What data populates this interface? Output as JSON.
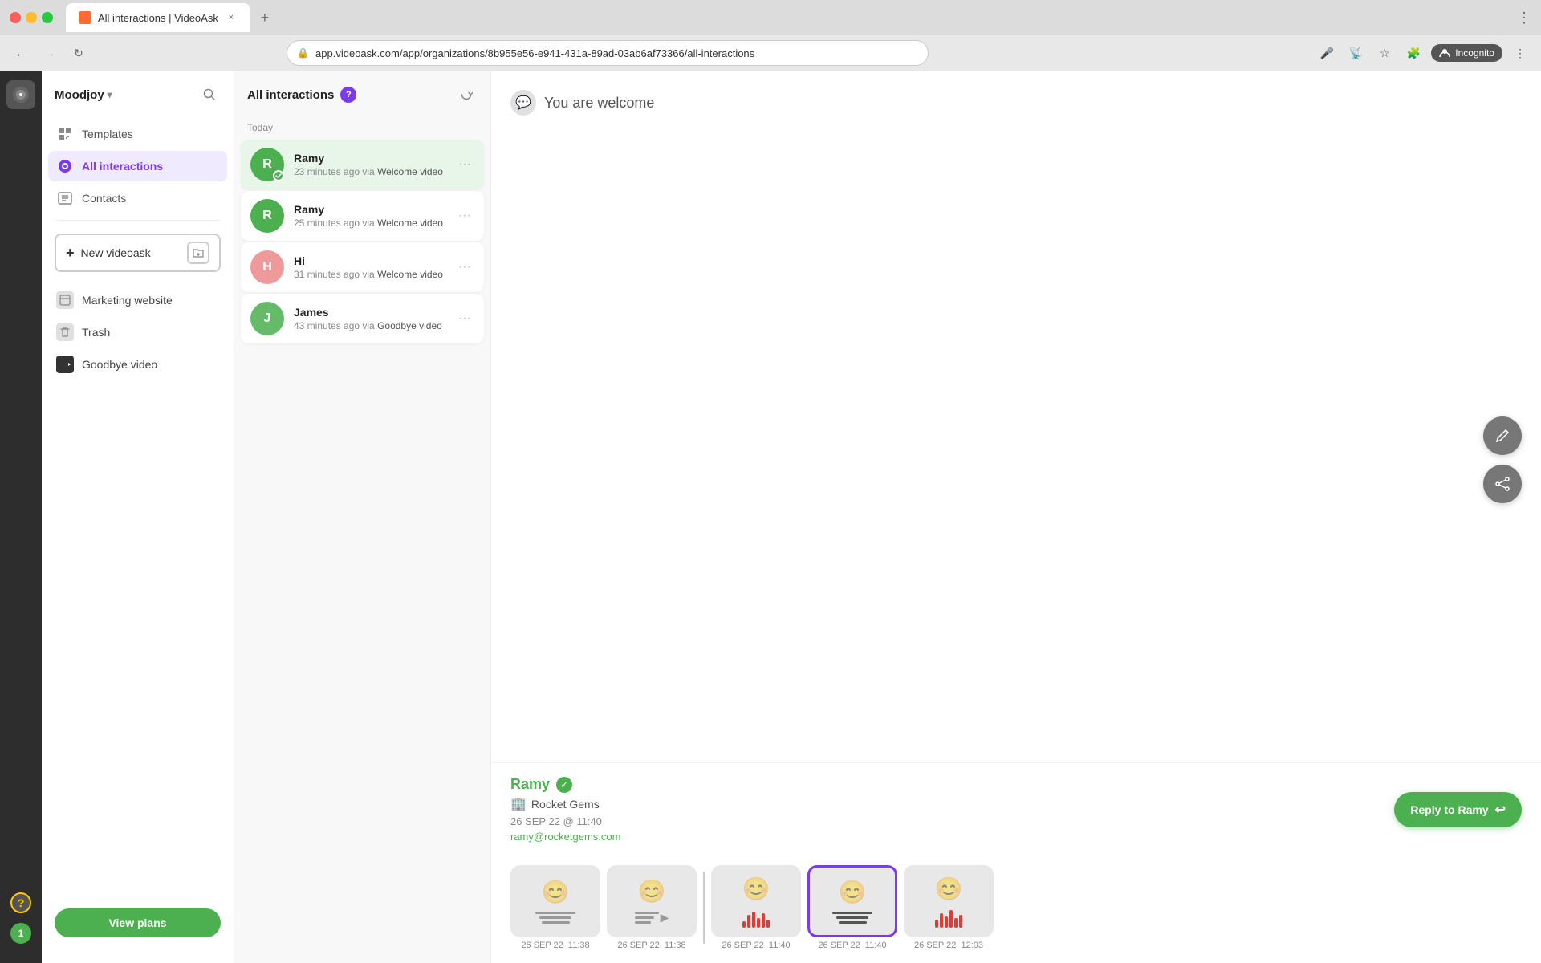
{
  "browser": {
    "tab_title": "All interactions | VideoAsk",
    "tab_close": "×",
    "new_tab": "+",
    "url": "app.videoask.com/app/organizations/8b955e56-e941-431a-89ad-03ab6af73366/all-interactions",
    "incognito_label": "Incognito"
  },
  "sidebar": {
    "org_name": "Moodjoy",
    "templates_label": "Templates",
    "all_interactions_label": "All interactions",
    "contacts_label": "Contacts",
    "new_videoask_label": "New videoask",
    "marketing_website_label": "Marketing website",
    "trash_label": "Trash",
    "goodbye_video_label": "Goodbye video",
    "view_plans_label": "View plans"
  },
  "interactions": {
    "title": "All interactions",
    "help_label": "?",
    "date_divider": "Today",
    "items": [
      {
        "name": "Ramy",
        "time": "23 minutes ago via ",
        "link": "Welcome video",
        "color": "#4caf50",
        "initial": "R",
        "has_status": true
      },
      {
        "name": "Ramy",
        "time": "25 minutes ago via ",
        "link": "Welcome video",
        "color": "#4caf50",
        "initial": "R",
        "has_status": false
      },
      {
        "name": "Hi",
        "time": "31 minutes ago via ",
        "link": "Welcome video",
        "color": "#ef9a9a",
        "initial": "H",
        "has_status": false
      },
      {
        "name": "James",
        "time": "43 minutes ago via ",
        "link": "Goodbye video",
        "color": "#66bb6a",
        "initial": "J",
        "has_status": false
      }
    ]
  },
  "main": {
    "welcome_text": "You are welcome",
    "contact_name": "Ramy",
    "contact_company": "Rocket Gems",
    "contact_date": "26 SEP 22 @ 11:40",
    "contact_email": "ramy@rocketgems.com",
    "reply_btn_label": "Reply to Ramy"
  },
  "thumbnails": [
    {
      "date": "26 SEP 22",
      "time": "11:38",
      "type": "face-lines",
      "active": false
    },
    {
      "date": "26 SEP 22",
      "time": "11:38",
      "type": "face-lines-arrow",
      "active": false
    },
    {
      "date": "26 SEP 22",
      "time": "11:40",
      "type": "face-bars",
      "active": false
    },
    {
      "date": "26 SEP 22",
      "time": "11:40",
      "type": "face-lines-text",
      "active": true
    },
    {
      "date": "26 SEP 22",
      "time": "12:03",
      "type": "face-bars-red",
      "active": false
    }
  ],
  "help": {
    "label": "?"
  },
  "notification": {
    "count": "1"
  }
}
